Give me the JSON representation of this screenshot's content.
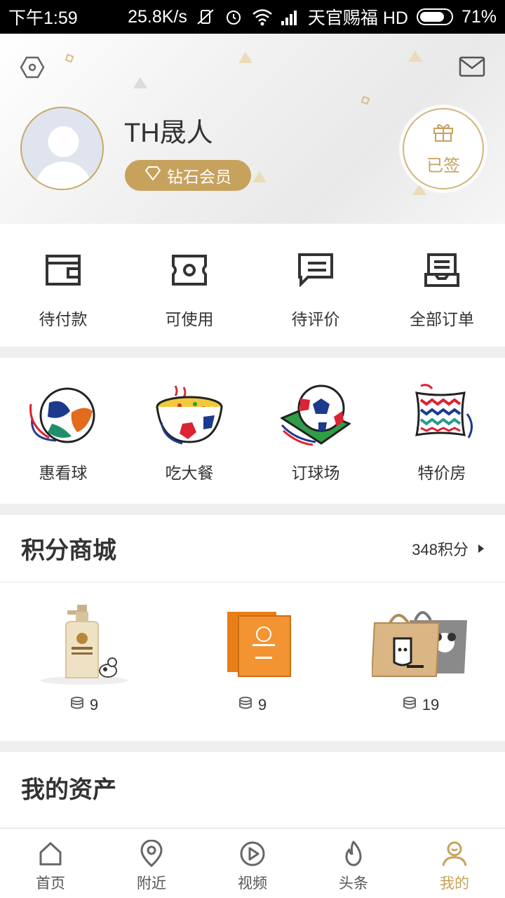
{
  "status_bar": {
    "time": "下午1:59",
    "speed": "25.8K/s",
    "carrier": "天官赐福 HD",
    "battery": "71%"
  },
  "profile": {
    "username": "TH晟人",
    "member_level": "钻石会员",
    "signin_label": "已签",
    "accent_color": "#c6a25c"
  },
  "orders": [
    {
      "label": "待付款",
      "icon": "wallet-icon"
    },
    {
      "label": "可使用",
      "icon": "ticket-icon"
    },
    {
      "label": "待评价",
      "icon": "comment-icon"
    },
    {
      "label": "全部订单",
      "icon": "orders-icon"
    }
  ],
  "services": [
    {
      "label": "惠看球",
      "icon": "football-icon"
    },
    {
      "label": "吃大餐",
      "icon": "meal-bowl-icon"
    },
    {
      "label": "订球场",
      "icon": "football-pitch-icon"
    },
    {
      "label": "特价房",
      "icon": "pillow-icon"
    }
  ],
  "mall": {
    "title": "积分商城",
    "points": "348积分",
    "products": [
      {
        "price": "9",
        "image": "lotion-bottle"
      },
      {
        "price": "9",
        "image": "face-mask-pack"
      },
      {
        "price": "19",
        "image": "tote-bags"
      }
    ]
  },
  "assets": {
    "title": "我的资产"
  },
  "tabbar": [
    {
      "label": "首页",
      "icon": "home-icon"
    },
    {
      "label": "附近",
      "icon": "location-icon"
    },
    {
      "label": "视频",
      "icon": "video-icon"
    },
    {
      "label": "头条",
      "icon": "flame-icon"
    },
    {
      "label": "我的",
      "icon": "profile-icon",
      "active": true
    }
  ]
}
